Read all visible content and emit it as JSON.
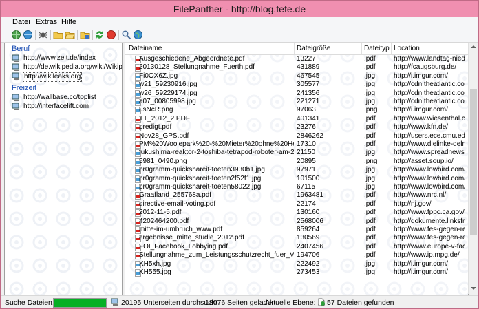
{
  "window": {
    "title": "FilePanther - http://blog.fefe.de"
  },
  "menu": {
    "items": [
      {
        "label": "Datei",
        "u": "D",
        "rest": "atei"
      },
      {
        "label": "Extras",
        "u": "E",
        "rest": "xtras"
      },
      {
        "label": "Hilfe",
        "u": "H",
        "rest": "ilfe"
      }
    ]
  },
  "toolbar": {
    "icons": [
      "globe-add-icon",
      "globe-remove-icon",
      "spider-icon",
      "folder-add-icon",
      "folder-open-icon",
      "folder-save-icon",
      "refresh-icon",
      "stop-icon",
      "search-icon",
      "web-icon"
    ]
  },
  "tree": {
    "groups": [
      {
        "label": "Beruf",
        "items": [
          {
            "text": "http://www.zeit.de/index",
            "selected": false
          },
          {
            "text": "http://de.wikipedia.org/wiki/Wikipedia:",
            "selected": false
          },
          {
            "text": "http://wikileaks.org",
            "selected": true
          }
        ]
      },
      {
        "label": "Freizeit",
        "items": [
          {
            "text": "http://wallbase.cc/toplist",
            "selected": false
          },
          {
            "text": "http://interfacelift.com",
            "selected": false
          }
        ]
      }
    ]
  },
  "table": {
    "columns": [
      "Dateiname",
      "Dateigröße",
      "Dateityp",
      "Location"
    ],
    "rows": [
      [
        "Ausgeschiedene_Abgeordnete.pdf",
        "13227",
        ".pdf",
        "http://www.landtag-nieder..."
      ],
      [
        "20130128_Stellungnahme_Fuerth.pdf",
        "431889",
        ".pdf",
        "http://fcaugsburg.de/"
      ],
      [
        "Fi0OX6Z.jpg",
        "467545",
        ".jpg",
        "http://i.imgur.com/"
      ],
      [
        "w21_59230916.jpg",
        "305577",
        ".jpg",
        "http://cdn.theatlantic.com/"
      ],
      [
        "w26_59229174.jpg",
        "241356",
        ".jpg",
        "http://cdn.theatlantic.com/"
      ],
      [
        "a07_00805998.jpg",
        "221271",
        ".jpg",
        "http://cdn.theatlantic.com/"
      ],
      [
        "usNcR.png",
        "97063",
        ".png",
        "http://i.imgur.com/"
      ],
      [
        "TT_2012_2.PDF",
        "401341",
        ".pdf",
        "http://www.wiesenthal.co..."
      ],
      [
        "predigt.pdf",
        "23276",
        ".pdf",
        "http://www.kfn.de/"
      ],
      [
        "Nov28_GPS.pdf",
        "2846262",
        ".pdf",
        "http://users.ece.cmu.edu/"
      ],
      [
        "PM%20Woolepark%20-%20Mieter%20ohne%20Heizung.pdf",
        "17310",
        ".pdf",
        "http://www.dielinke-delme..."
      ],
      [
        "fukushima-reaktor-2-toshiba-tetrapod-roboter-am-2012-12-1...",
        "21150",
        ".jpg",
        "http://www.spreadnews.de/"
      ],
      [
        "5981_0490.png",
        "20895",
        ".png",
        "http://asset.soup.io/"
      ],
      [
        "pr0gramm-quickshareit-toeten3930b1.jpg",
        "97971",
        ".jpg",
        "http://www.lowbird.com/"
      ],
      [
        "pr0gramm-quickshareit-toeten2f52f1.jpg",
        "101500",
        ".jpg",
        "http://www.lowbird.com/"
      ],
      [
        "pr0gramm-quickshareit-toeten58022.jpg",
        "67115",
        ".jpg",
        "http://www.lowbird.com/"
      ],
      [
        "Graafland_255768a.pdf",
        "1963481",
        ".pdf",
        "http://www.nrc.nl/"
      ],
      [
        "directive-email-voting.pdf",
        "22174",
        ".pdf",
        "http://nj.gov/"
      ],
      [
        "2012-11-5.pdf",
        "130160",
        ".pdf",
        "http://www.fppc.ca.gov/"
      ],
      [
        "4202464200.pdf",
        "2568006",
        ".pdf",
        "http://dokumente.linksfrak..."
      ],
      [
        "mitte-im-umbruch_www.pdf",
        "859264",
        ".pdf",
        "http://www.fes-gegen-rec..."
      ],
      [
        "ergebnisse_mitte_studie_2012.pdf",
        "130569",
        ".pdf",
        "http://www.fes-gegen-rec..."
      ],
      [
        "FOI_Facebook_Lobbying.pdf",
        "2407456",
        ".pdf",
        "http://www.europe-v-face..."
      ],
      [
        "Stellungnahme_zum_Leistungsschutzrecht_fuer_Verleger....",
        "194706",
        ".pdf",
        "http://www.ip.mpg.de/"
      ],
      [
        "KH5xh.jpg",
        "222492",
        ".jpg",
        "http://i.imgur.com/"
      ],
      [
        "KH555.jpg",
        "273453",
        ".jpg",
        "http://i.imgur.com/"
      ]
    ]
  },
  "status": {
    "searching": "Suche Dateien...",
    "progress": 1.0,
    "subpages": "20195 Unterseiten durchsucht",
    "loaded": "18076 Seiten geladen",
    "level": "Aktuelle Ebene: 11",
    "found": "57 Dateien gefunden"
  },
  "colors": {
    "accent": "#f08fb0",
    "progress": "#06b025",
    "group": "#1e50b4"
  }
}
